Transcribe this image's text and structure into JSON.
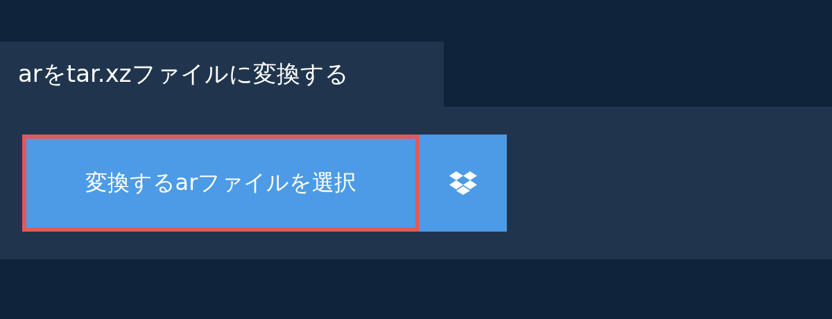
{
  "tab": {
    "title": "arをtar.xzファイルに変換する"
  },
  "select_button": {
    "label": "変換するarファイルを選択",
    "focused": true
  },
  "cloud_button": {
    "focused": false
  }
}
